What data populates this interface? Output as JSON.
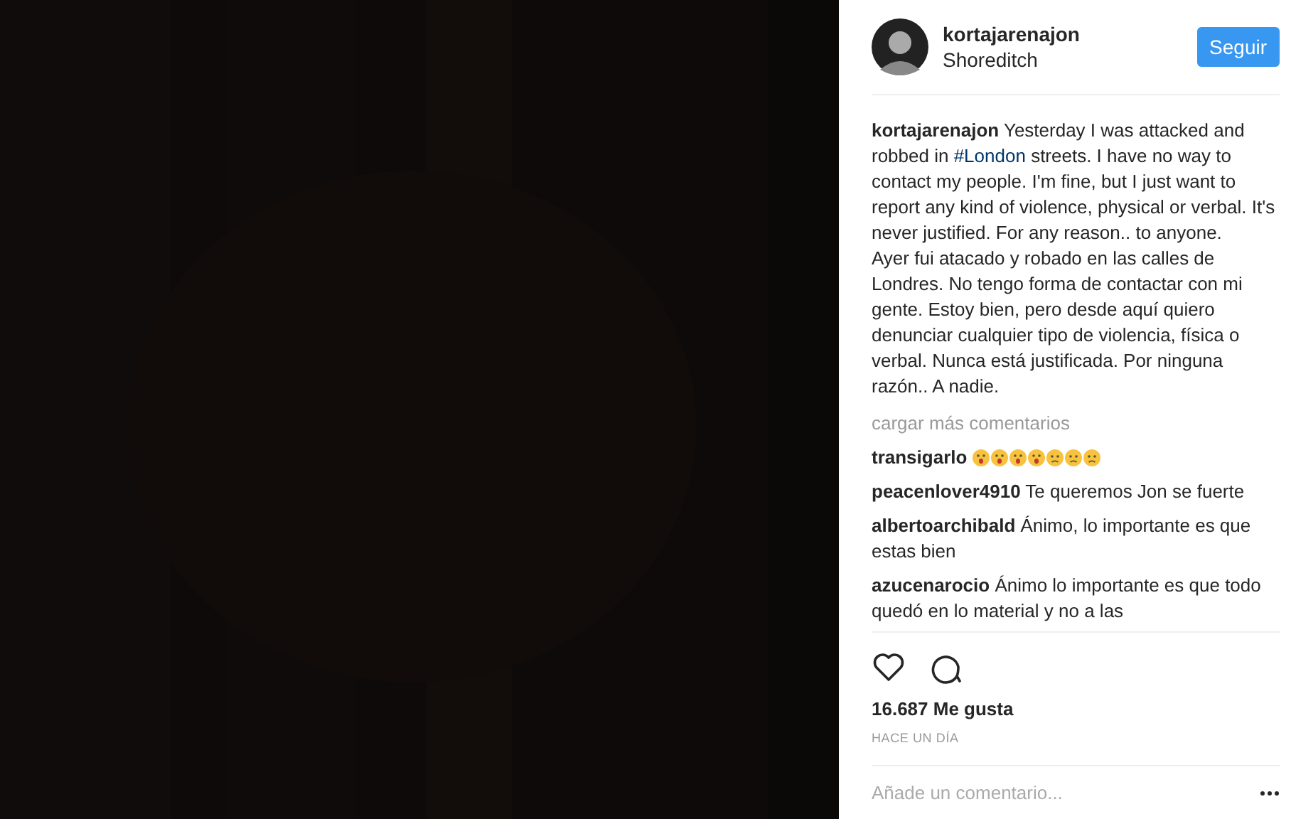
{
  "header": {
    "username": "kortajarenajon",
    "location": "Shoreditch",
    "follow_button": "Seguir"
  },
  "caption": {
    "username": "kortajarenajon",
    "text_before": "Yesterday I was attacked and robbed in",
    "hashtag": "#London",
    "text_after": "streets. I have no way to contact my people. I'm fine, but I just want to report any kind of violence, physical or verbal. It's never justified. For any reason.. to anyone.",
    "translation": "Ayer fui atacado y robado en las calles de Londres. No tengo forma de contactar con mi gente. Estoy bien, pero desde aquí quiero denunciar cualquier tipo de violencia, física o verbal. Nunca está justificada. Por ninguna razón.. A nadie."
  },
  "load_more": "cargar más comentarios",
  "comments": [
    {
      "username": "transigarlo",
      "emojis": [
        {
          "kind": "astonished"
        },
        {
          "kind": "astonished"
        },
        {
          "kind": "astonished"
        },
        {
          "kind": "astonished"
        },
        {
          "kind": "worried"
        },
        {
          "kind": "worried"
        },
        {
          "kind": "worried"
        }
      ]
    },
    {
      "username": "peacenlover4910",
      "text": "Te queremos Jon se fuerte"
    },
    {
      "username": "albertoarchibald",
      "text": "Ánimo, lo importante es que estas bien"
    },
    {
      "username": "azucenarocio",
      "text": "Ánimo lo importante es que todo quedó en lo material y no a las"
    }
  ],
  "likes": "16.687 Me gusta",
  "timestamp": "HACE UN DÍA",
  "comment_input": {
    "placeholder": "Añade un comentario..."
  }
}
